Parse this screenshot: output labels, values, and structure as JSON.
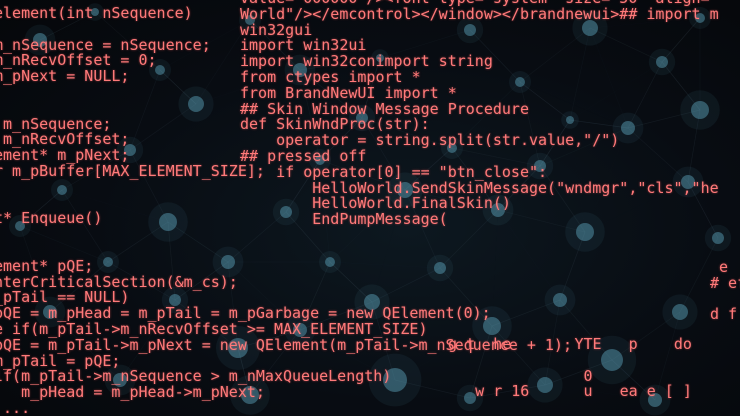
{
  "code_left": [
    "element(int nSequence)",
    "",
    "m_nSequence = nSequence;",
    "m_nRecvOffset = 0;",
    "m_pNext = NULL;",
    "",
    "",
    " m_nSequence;",
    " m_nRecvOffset;",
    "ement* m_pNext;",
    "r m_pBuffer[MAX_ELEMENT_SIZE];",
    "",
    "",
    "t* Enqueue()",
    "",
    "",
    "ement* pQE;",
    "nterCriticalSection(&m_cs);",
    "_pTail == NULL)",
    "pQE = m_pHead = m_pTail = m_pGarbage = new QElement(0);",
    "e if(m_pTail->m_nRecvOffset >= MAX_ELEMENT_SIZE)",
    "pQE = m_pTail->m_pNext = new QElement(m_pTail->m_nSequence + 1);",
    "m_pTail = pQE;",
    "lf(m_pTail->m_nSequence > m_nMaxQueueLength)",
    "   m_pHead = m_pHead->m_pNext;",
    " ..."
  ],
  "code_right": [
    "value= 000000 /><font type= system  size= 50  align=",
    "World\"/></emcontrol></window></brandnewui>## import m",
    "win32gui",
    "import win32ui",
    "import win32conimport string",
    "from ctypes import *",
    "from BrandNewUI import *",
    "## Skin Window Message Procedure",
    "def SkinWndProc(str):",
    "    operator = string.split(str.value,\"/\")",
    "## pressed off",
    "    if operator[0] == \"btn_close\":",
    "        HelloWorld.SendSkinMessage(\"wndmgr\",\"cls\",\"he",
    "        HelloWorld.FinalSkin()",
    "        EndPumpMessage("
  ],
  "code_tail": [
    "  g t  he       YTE   p    do",
    "",
    "                 0",
    "     w r 16      u   ea e [ ]"
  ],
  "code_edge": [
    " e",
    "# ef",
    "",
    "d f"
  ],
  "colors": {
    "code_text": "#ff7a7a",
    "network_node": "#5fa8c0",
    "background": "#070b10"
  }
}
